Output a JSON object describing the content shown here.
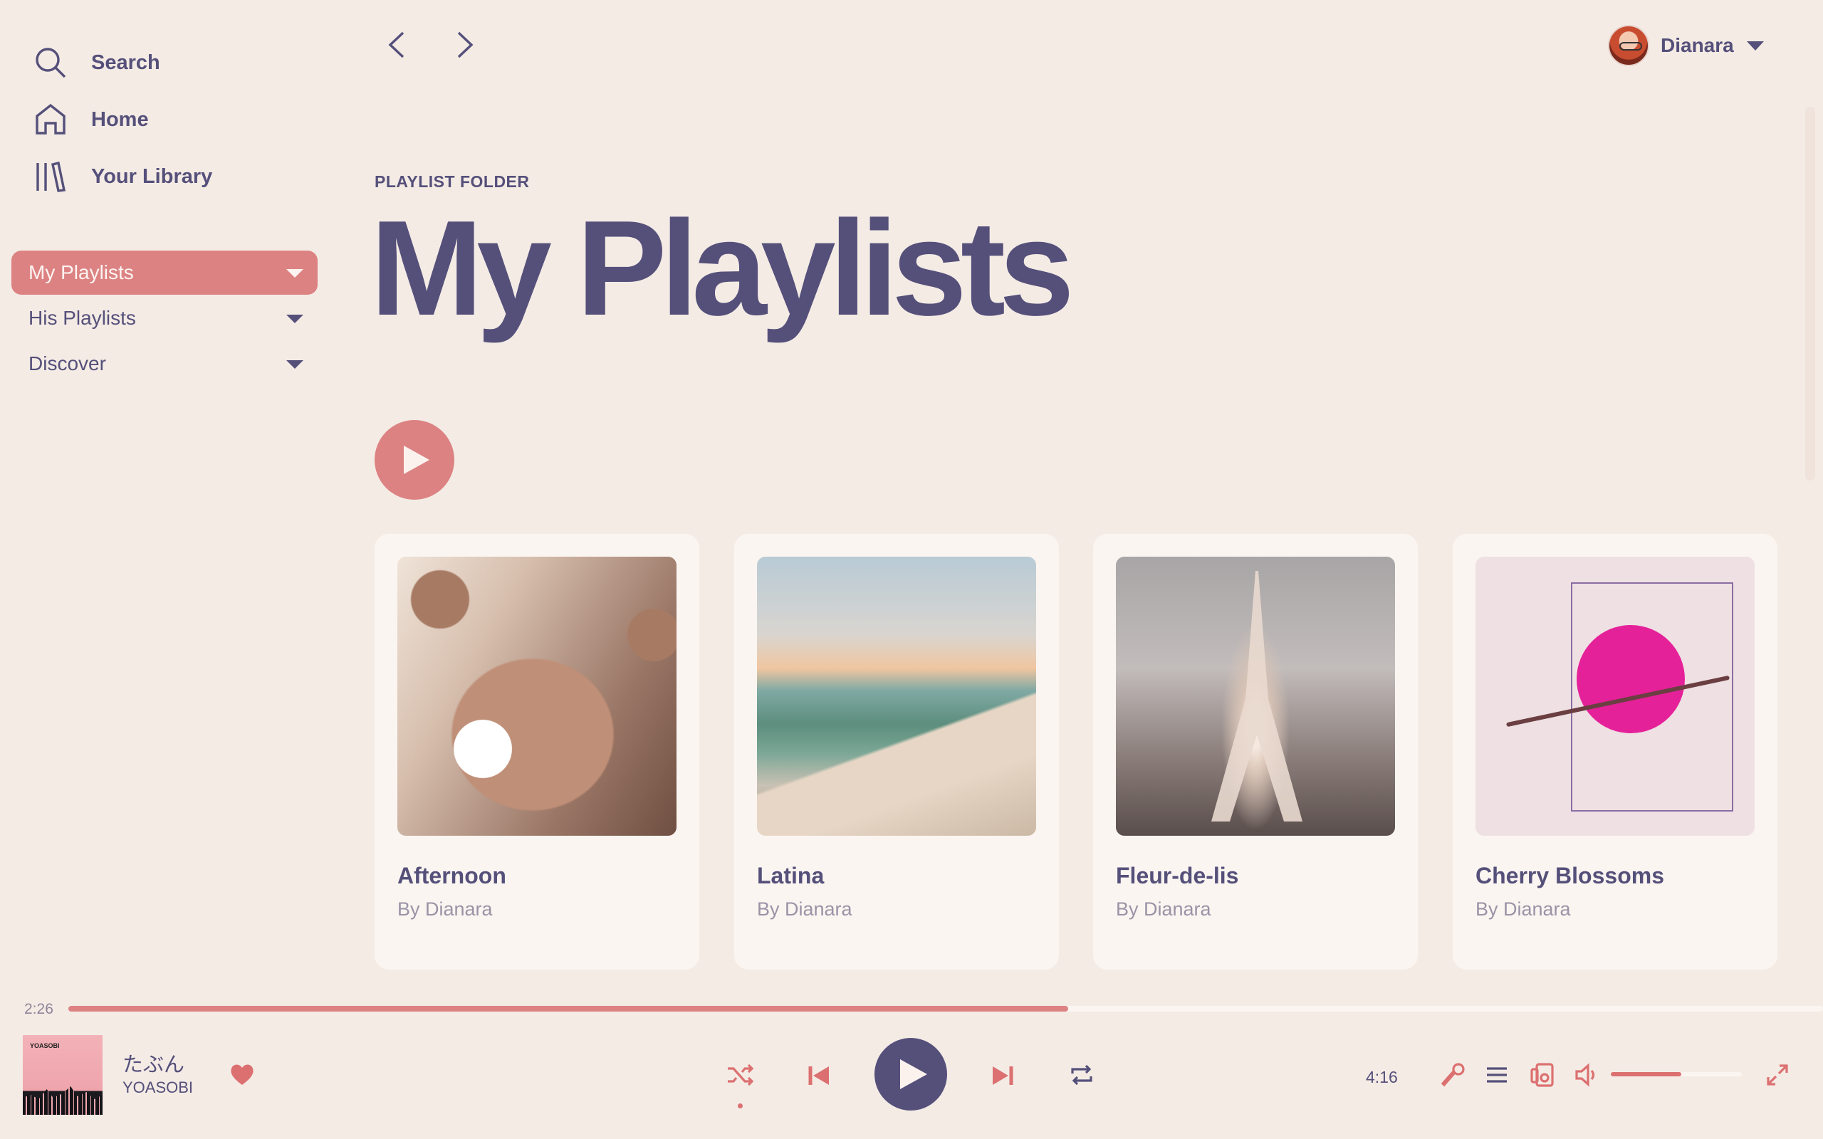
{
  "sidebar": {
    "nav": [
      {
        "label": "Search",
        "icon": "search-icon"
      },
      {
        "label": "Home",
        "icon": "home-icon"
      },
      {
        "label": "Your Library",
        "icon": "library-icon"
      }
    ],
    "folders": [
      {
        "label": "My Playlists",
        "active": true
      },
      {
        "label": "His Playlists",
        "active": false
      },
      {
        "label": "Discover",
        "active": false
      }
    ]
  },
  "topbar": {
    "user_name": "Dianara"
  },
  "header": {
    "type": "PLAYLIST FOLDER",
    "title": "My Playlists"
  },
  "playlists": [
    {
      "title": "Afternoon",
      "owner": "By Dianara"
    },
    {
      "title": "Latina",
      "owner": "By Dianara"
    },
    {
      "title": "Fleur-de-lis",
      "owner": "By Dianara"
    },
    {
      "title": "Cherry Blossoms",
      "owner": "By Dianara"
    }
  ],
  "player": {
    "elapsed": "2:26",
    "duration": "4:16",
    "progress_fraction": 0.57,
    "volume_fraction": 0.54,
    "track": "たぶん",
    "artist": "YOASOBI",
    "album_art_text": "YOASOBI",
    "liked": true,
    "shuffle_on": true
  },
  "colors": {
    "background": "#f4ebe5",
    "accent": "#dc8282",
    "text": "#55507a",
    "card": "#fbf5f1"
  }
}
